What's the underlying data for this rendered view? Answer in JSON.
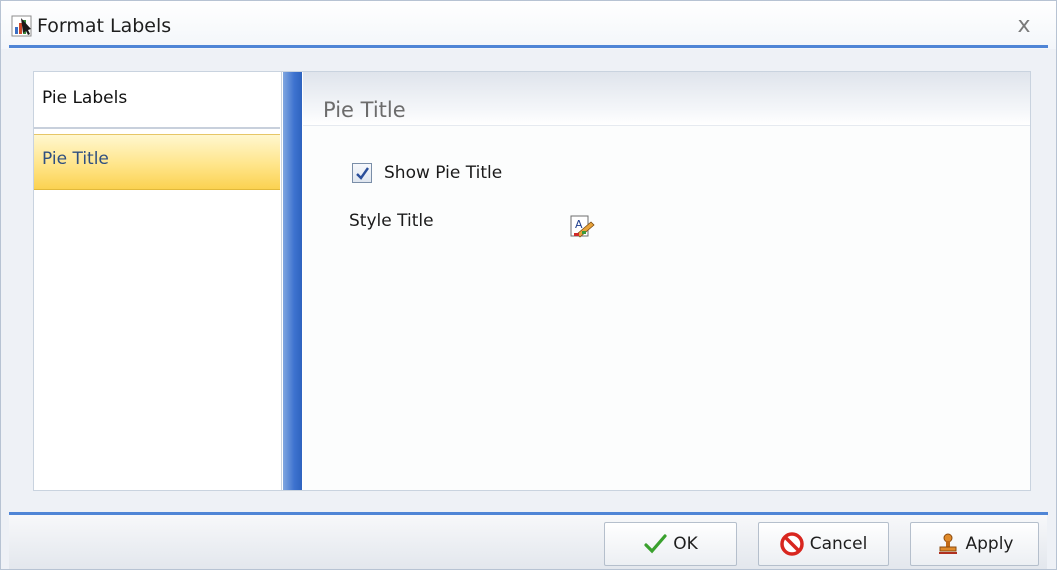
{
  "window": {
    "title": "Format Labels",
    "close_glyph": "x"
  },
  "nav": {
    "items": [
      {
        "label": "Pie Labels",
        "selected": false
      },
      {
        "label": "Pie Title",
        "selected": true
      }
    ]
  },
  "panel": {
    "section_title": "Pie Title",
    "show_title": {
      "label": "Show Pie Title",
      "checked": true
    },
    "style_title_label": "Style Title",
    "style_icon": "style-edit-icon"
  },
  "footer": {
    "ok_label": "OK",
    "cancel_label": "Cancel",
    "apply_label": "Apply"
  },
  "colors": {
    "accent_line": "#4f85d6",
    "selection": "#ffe58a",
    "splitter": "#3d72cf"
  }
}
